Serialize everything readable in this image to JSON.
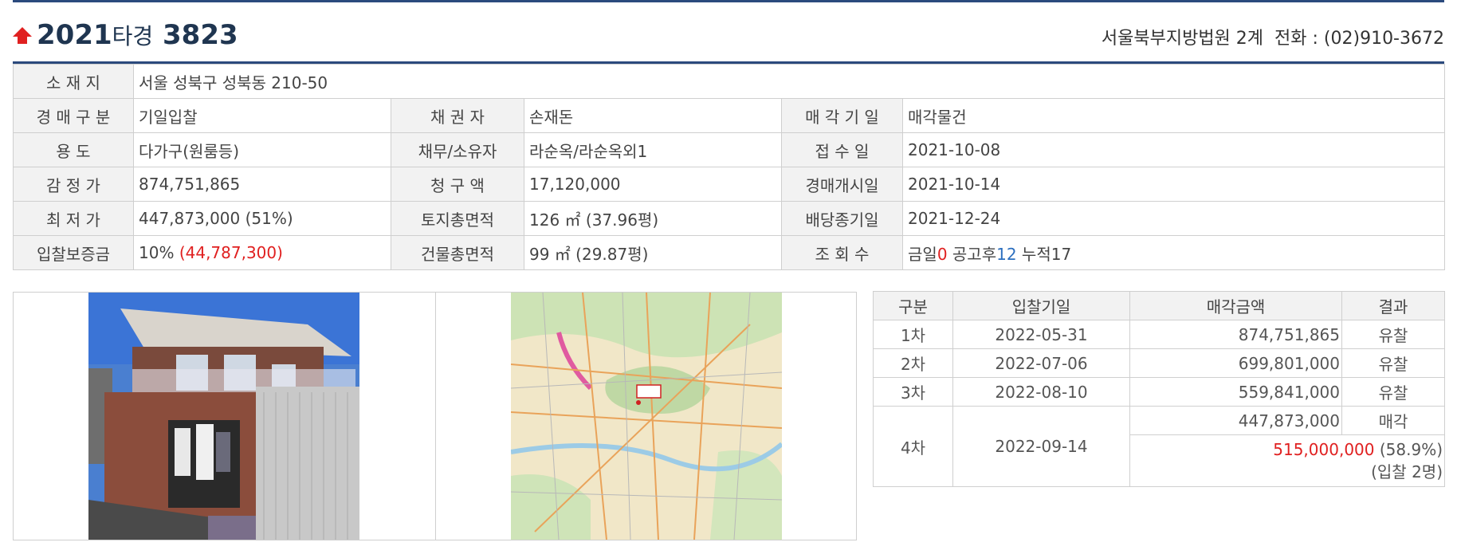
{
  "header": {
    "case_year": "2021",
    "case_type": "타경",
    "case_number": "3823",
    "court": "서울북부지방법원 2계",
    "phone_label": "전화 : (02)910-3672"
  },
  "info": {
    "location": {
      "label": "소 재 지",
      "value": "서울 성북구 성북동 210-50"
    },
    "rows": [
      {
        "l1": "경 매 구 분",
        "v1": "기일입찰",
        "l2": "채  권  자",
        "v2": "손재돈",
        "l3": "매 각 기 일",
        "v3": "매각물건"
      },
      {
        "l1": "용     도",
        "v1": "다가구(원룸등)",
        "l2": "채무/소유자",
        "v2": "라순옥/라순옥외1",
        "l3": "접  수  일",
        "v3": "2021-10-08"
      },
      {
        "l1": "감  정  가",
        "v1": "874,751,865",
        "l2": "청  구  액",
        "v2": "17,120,000",
        "l3": "경매개시일",
        "v3": "2021-10-14"
      },
      {
        "l1": "최  저  가",
        "v1": "447,873,000 (51%)",
        "l2": "토지총면적",
        "v2": "126 ㎡ (37.96평)",
        "l3": "배당종기일",
        "v3": "2021-12-24"
      }
    ],
    "deposit": {
      "label": "입찰보증금",
      "pct": "10% ",
      "amount": "(44,787,300)"
    },
    "building_area": {
      "label": "건물총면적",
      "value": "99 ㎡ (29.87평)"
    },
    "views": {
      "label": "조  회  수",
      "today_label": "금일",
      "today": "0",
      "after_label": " 공고후",
      "after": "12",
      "total_label": " 누적",
      "total": "17"
    }
  },
  "bids": {
    "headers": {
      "round": "구분",
      "date": "입찰기일",
      "amount": "매각금액",
      "result": "결과"
    },
    "rows": [
      {
        "round": "1차",
        "date": "2022-05-31",
        "amount": "874,751,865",
        "result": "유찰"
      },
      {
        "round": "2차",
        "date": "2022-07-06",
        "amount": "699,801,000",
        "result": "유찰"
      },
      {
        "round": "3차",
        "date": "2022-08-10",
        "amount": "559,841,000",
        "result": "유찰"
      }
    ],
    "final": {
      "round": "4차",
      "date": "2022-09-14",
      "amount": "447,873,000",
      "result": "매각",
      "sale_price": "515,000,000",
      "sale_pct": " (58.9%)",
      "bidders": "(입찰 2명)"
    }
  },
  "colors": {
    "accent": "#2b4a7d",
    "red": "#e02020",
    "blue": "#2c6fbf"
  }
}
